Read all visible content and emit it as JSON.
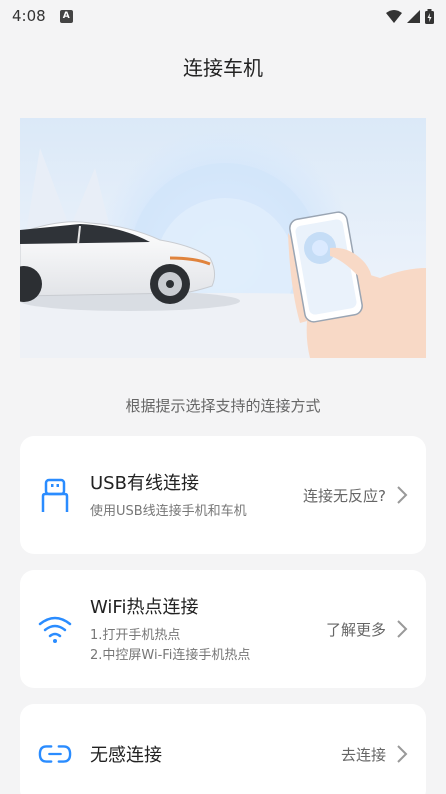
{
  "status_bar": {
    "time": "4:08",
    "notif_letter": "A"
  },
  "header": {
    "title": "连接车机"
  },
  "subtitle": "根据提示选择支持的连接方式",
  "cards": [
    {
      "title": "USB有线连接",
      "desc": [
        "使用USB线连接手机和车机"
      ],
      "action": "连接无反应?"
    },
    {
      "title": "WiFi热点连接",
      "desc": [
        "1.打开手机热点",
        "2.中控屏Wi-Fi连接手机热点"
      ],
      "action": "了解更多"
    },
    {
      "title": "无感连接",
      "desc": [],
      "action": "去连接"
    }
  ],
  "colors": {
    "accent": "#2a8cff",
    "bg": "#f4f4f5"
  }
}
